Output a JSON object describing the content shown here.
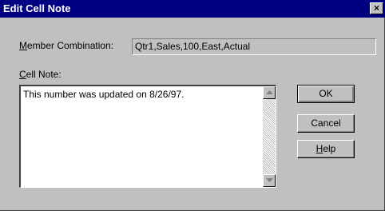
{
  "window": {
    "title": "Edit Cell Note",
    "close_glyph": "×"
  },
  "member": {
    "label": "Member Combination:",
    "label_mnemonic": "M",
    "label_rest": "ember Combination:",
    "value": "Qtr1,Sales,100,East,Actual"
  },
  "note": {
    "label": "Cell Note:",
    "label_mnemonic": "C",
    "label_rest": "ell Note:",
    "text": "This number was updated on 8/26/97."
  },
  "buttons": {
    "ok": "OK",
    "cancel": "Cancel",
    "help": "Help",
    "help_mnemonic": "H",
    "help_rest": "elp"
  },
  "icons": {
    "close": "close-icon",
    "scroll_up": "scroll-up-arrow-icon",
    "scroll_down": "scroll-down-arrow-icon"
  },
  "colors": {
    "titlebar": "#000080",
    "face": "#c0c0c0",
    "field": "#ffffff"
  }
}
